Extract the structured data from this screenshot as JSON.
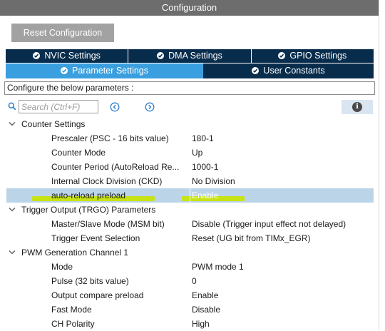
{
  "panel": {
    "title": "Configuration"
  },
  "toolbar": {
    "reset_label": "Reset Configuration"
  },
  "tabs": {
    "row1": [
      {
        "label": "NVIC Settings",
        "icon": "check-circle-icon"
      },
      {
        "label": "DMA Settings",
        "icon": "check-circle-icon"
      },
      {
        "label": "GPIO Settings",
        "icon": "check-circle-icon"
      }
    ],
    "row2": [
      {
        "label": "Parameter Settings",
        "icon": "check-circle-icon",
        "selected": true
      },
      {
        "label": "User Constants",
        "icon": "check-circle-icon"
      }
    ]
  },
  "configure_text": "Configure the below parameters :",
  "search": {
    "placeholder": "Search (Ctrl+F)",
    "value": ""
  },
  "colors": {
    "title_bar": "#6d6d6d",
    "tab_dark": "#082c4c",
    "tab_active": "#3a9fdf",
    "selected_row": "#bcd4e8",
    "highlighter": "#c9e400"
  },
  "tree": {
    "counter": {
      "label": "Counter Settings",
      "params": [
        {
          "name": "Prescaler (PSC - 16 bits value)",
          "value": "180-1"
        },
        {
          "name": "Counter Mode",
          "value": "Up"
        },
        {
          "name": "Counter Period (AutoReload Re...",
          "value": "1000-1"
        },
        {
          "name": "Internal Clock Division (CKD)",
          "value": "No Division"
        },
        {
          "name": "auto-reload preload",
          "value": "Enable"
        }
      ]
    },
    "trigger": {
      "label": "Trigger Output (TRGO) Parameters",
      "params": [
        {
          "name": "Master/Slave Mode (MSM bit)",
          "value": "Disable (Trigger input effect not delayed)"
        },
        {
          "name": "Trigger Event Selection",
          "value": "Reset (UG bit from TIMx_EGR)"
        }
      ]
    },
    "pwm": {
      "label": "PWM Generation Channel 1",
      "params": [
        {
          "name": "Mode",
          "value": "PWM mode 1"
        },
        {
          "name": "Pulse (32 bits value)",
          "value": "0"
        },
        {
          "name": "Output compare preload",
          "value": "Enable"
        },
        {
          "name": "Fast Mode",
          "value": "Disable"
        },
        {
          "name": "CH Polarity",
          "value": "High"
        }
      ]
    }
  }
}
